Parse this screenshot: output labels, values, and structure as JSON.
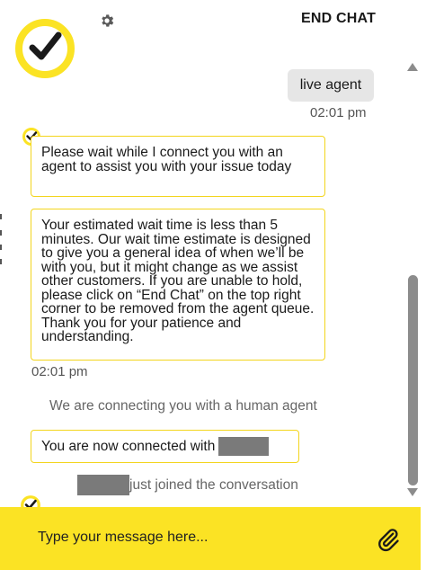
{
  "header": {
    "end_chat_label": "END CHAT"
  },
  "messages": {
    "user_text": "live agent",
    "user_time": "02:01 pm",
    "agent_1": "Please wait while I connect you with an agent to assist you with your issue today",
    "agent_2": "Your estimated wait time is less than 5 minutes. Our wait time estimate is designed to give you a general idea of when we’ll be with you, but it might change as we assist other customers. If you are unable to hold, please click on “End Chat” on the top right corner to be removed from the agent queue. Thank you for your patience and understanding.",
    "agent_time": "02:01 pm",
    "system_note": "We are connecting you with a human agent",
    "connected_text": "You are now connected with",
    "joined_text": "just joined the conversation"
  },
  "composer": {
    "placeholder": "Type your message here..."
  },
  "icons": {
    "logo": "check-circle-logo-icon",
    "settings": "gear-icon",
    "attach": "paperclip-icon",
    "scroll_up": "triangle-up-icon",
    "scroll_down": "triangle-down-icon"
  },
  "colors": {
    "brand_yellow": "#fbe324",
    "bubble_border": "#f3d51d",
    "user_bubble_bg": "#e6e6e6",
    "redaction": "#7a7a7a"
  }
}
